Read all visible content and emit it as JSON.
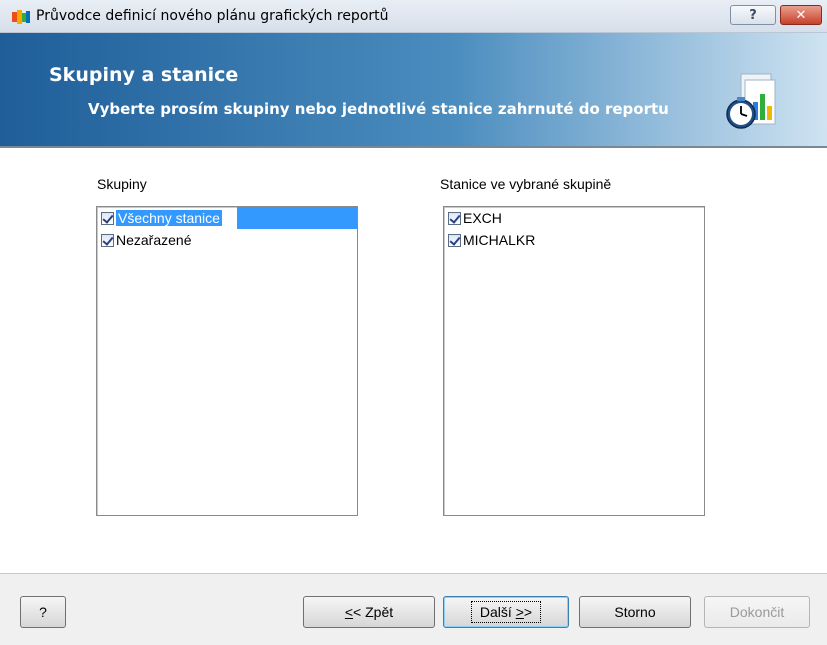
{
  "window": {
    "title": "Průvodce definicí nového plánu grafických reportů",
    "help_button": "?",
    "close_button": "✕"
  },
  "header": {
    "title": "Skupiny a stanice",
    "subtitle": "Vyberte prosím skupiny nebo jednotlivé stanice zahrnuté do reportu",
    "icon": "report-clock-chart-icon"
  },
  "groups": {
    "label": "Skupiny",
    "items": [
      {
        "label": "Všechny stanice",
        "checked": true,
        "selected": true
      },
      {
        "label": "Nezařazené",
        "checked": true,
        "selected": false
      }
    ]
  },
  "stations": {
    "label": "Stanice ve vybrané skupině",
    "items": [
      {
        "label": "EXCH",
        "checked": true
      },
      {
        "label": "MICHALKR",
        "checked": true
      }
    ]
  },
  "footer": {
    "help": "?",
    "back_prefix": "<",
    "back_rest": "< Zpět",
    "next_prefix": "Další ",
    "next_underlined": ">",
    "next_suffix": ">",
    "cancel": "Storno",
    "finish": "Dokončit"
  },
  "colors": {
    "header_start": "#1f5e99",
    "header_end": "#cfe3f2",
    "selection": "#3399ff",
    "close_button": "#c8402a"
  }
}
